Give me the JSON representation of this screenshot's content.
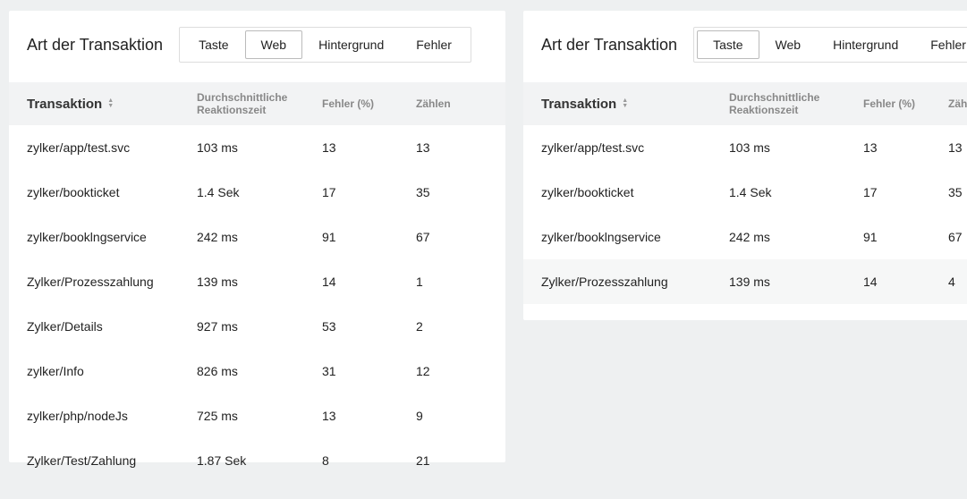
{
  "left": {
    "headerTitle": "Art der Transaktion",
    "tabs": [
      "Taste",
      "Web",
      "Hintergrund",
      "Fehler"
    ],
    "activeTab": 1,
    "columns": {
      "transaction": "Transaktion",
      "avg": "Durchschnittliche Reaktionszeit",
      "error": "Fehler (%)",
      "count": "Zählen"
    },
    "rows": [
      {
        "name": "zylker/app/test.svc",
        "avg": "103 ms",
        "err": "13",
        "count": "13"
      },
      {
        "name": "zylker/bookticket",
        "avg": "1.4 Sek",
        "err": "17",
        "count": "35"
      },
      {
        "name": "zylker/booklngservice",
        "avg": "242 ms",
        "err": "91",
        "count": "67"
      },
      {
        "name": "Zylker/Prozesszahlung",
        "avg": "139 ms",
        "err": "14",
        "count": "1"
      },
      {
        "name": "Zylker/Details",
        "avg": "927 ms",
        "err": "53",
        "count": "2"
      },
      {
        "name": "zylker/Info",
        "avg": "826 ms",
        "err": "31",
        "count": "12"
      },
      {
        "name": "zylker/php/nodeJs",
        "avg": "725 ms",
        "err": "13",
        "count": "9"
      },
      {
        "name": "Zylker/Test/Zahlung",
        "avg": "1.87 Sek",
        "err": "8",
        "count": "21"
      }
    ]
  },
  "right": {
    "headerTitle": "Art der Transaktion",
    "tabs": [
      "Taste",
      "Web",
      "Hintergrund",
      "Fehler"
    ],
    "activeTab": 0,
    "columns": {
      "transaction": "Transaktion",
      "avg": "Durchschnittliche Reaktionszeit",
      "error": "Fehler (%)",
      "count": "Zählen"
    },
    "rows": [
      {
        "name": "zylker/app/test.svc",
        "avg": "103 ms",
        "err": "13",
        "count": "13"
      },
      {
        "name": "zylker/bookticket",
        "avg": "1.4 Sek",
        "err": "17",
        "count": "35"
      },
      {
        "name": "zylker/booklngservice",
        "avg": "242 ms",
        "err": "91",
        "count": "67"
      },
      {
        "name": "Zylker/Prozesszahlung",
        "avg": "139 ms",
        "err": "14",
        "count": "4"
      }
    ],
    "altRow": 3
  }
}
